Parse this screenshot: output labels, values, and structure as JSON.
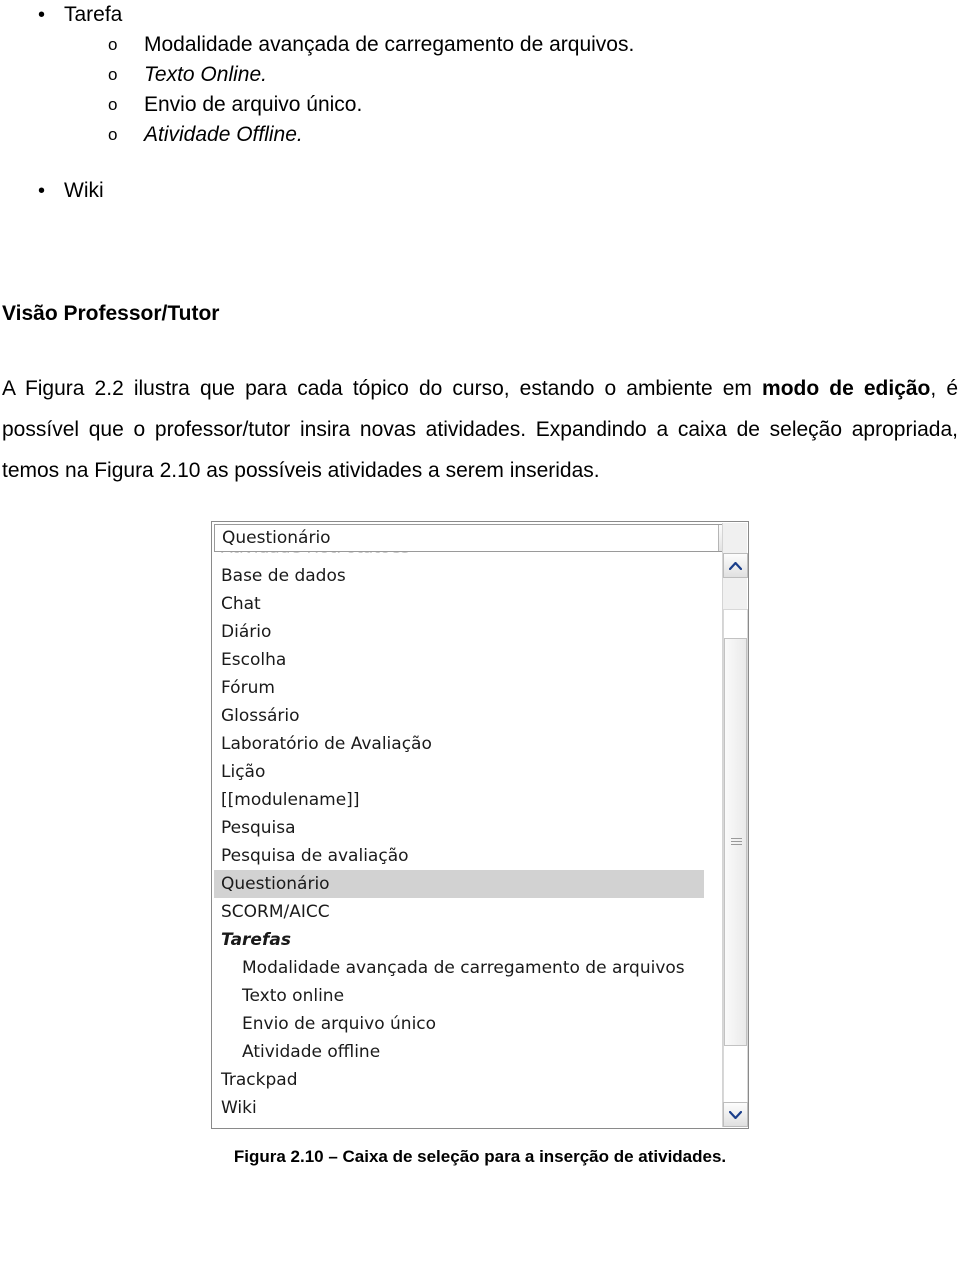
{
  "document": {
    "top_list": [
      {
        "marker": "bullet",
        "text": "Tarefa",
        "italic": false
      },
      {
        "marker": "o",
        "text": "Modalidade avançada de carregamento de arquivos.",
        "italic": false
      },
      {
        "marker": "o",
        "text": "Texto Online.",
        "italic": true
      },
      {
        "marker": "o",
        "text": "Envio de arquivo único.",
        "italic": false
      },
      {
        "marker": "o",
        "text": "Atividade Offline.",
        "italic": true
      },
      {
        "marker": "bullet",
        "text": "Wiki",
        "italic": false
      }
    ],
    "heading": "Visão Professor/Tutor",
    "paragraph_parts": [
      {
        "text": "A Figura 2.2 ilustra que para cada tópico do curso, estando o ambiente em ",
        "bold": false
      },
      {
        "text": "modo de edição",
        "bold": true
      },
      {
        "text": ", é possível que o professor/tutor insira novas atividades. Expandindo a caixa de seleção apropriada, temos na Figura 2.10 as possíveis atividades a serem inseridas.",
        "bold": false
      }
    ],
    "caption": "Figura 2.10 – Caixa de seleção para a inserção de atividades."
  },
  "select_widget": {
    "combo_value": "Questionário",
    "clipped_top_item": "Atividade HotPotatoes",
    "options": [
      {
        "label": "Base de dados",
        "state": "normal"
      },
      {
        "label": "Chat",
        "state": "normal"
      },
      {
        "label": "Diário",
        "state": "normal"
      },
      {
        "label": "Escolha",
        "state": "normal"
      },
      {
        "label": "Fórum",
        "state": "normal"
      },
      {
        "label": "Glossário",
        "state": "normal"
      },
      {
        "label": "Laboratório de Avaliação",
        "state": "normal"
      },
      {
        "label": "Lição",
        "state": "normal"
      },
      {
        "label": "[[modulename]]",
        "state": "normal"
      },
      {
        "label": "Pesquisa",
        "state": "normal"
      },
      {
        "label": "Pesquisa de avaliação",
        "state": "normal"
      },
      {
        "label": "Questionário",
        "state": "selected"
      },
      {
        "label": "SCORM/AICC",
        "state": "normal"
      },
      {
        "label": "Tarefas",
        "state": "group"
      },
      {
        "label": "Modalidade avançada de carregamento de arquivos",
        "state": "child"
      },
      {
        "label": "Texto online",
        "state": "child"
      },
      {
        "label": "Envio de arquivo único",
        "state": "child"
      },
      {
        "label": "Atividade offline",
        "state": "child"
      },
      {
        "label": "Trackpad",
        "state": "normal"
      },
      {
        "label": "Wiki",
        "state": "normal"
      }
    ],
    "colors": {
      "selected_bg": "#d2d2d2",
      "border": "#8a8a8a"
    }
  }
}
